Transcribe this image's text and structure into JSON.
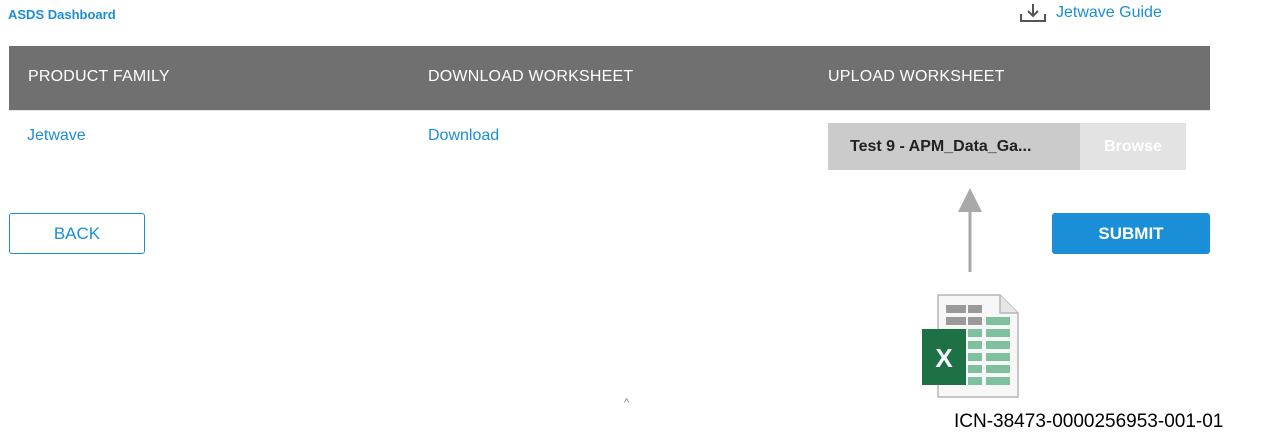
{
  "header": {
    "breadcrumb": "ASDS Dashboard",
    "guide_link": "Jetwave Guide",
    "guide_icon": "download-icon"
  },
  "table": {
    "columns": [
      "PRODUCT FAMILY",
      "DOWNLOAD WORKSHEET",
      "UPLOAD WORKSHEET"
    ],
    "rows": [
      {
        "product_family": "Jetwave",
        "download": "Download",
        "upload_file": "Test 9 - APM_Data_Ga...",
        "browse": "Browse"
      }
    ]
  },
  "actions": {
    "back": "BACK",
    "submit": "SUBMIT"
  },
  "illustration": {
    "arrow_icon": "arrow-up-icon",
    "file_icon": "excel-file-icon",
    "file_icon_letter": "X"
  },
  "footer": {
    "small_mark": "^",
    "icn": "ICN-38473-0000256953-001-01"
  },
  "colors": {
    "accent": "#1a8fd8",
    "header_bg": "#707070",
    "file_field_bg": "#cbcbcb",
    "browse_bg": "#e3e3e3",
    "excel_green": "#1e7145"
  }
}
